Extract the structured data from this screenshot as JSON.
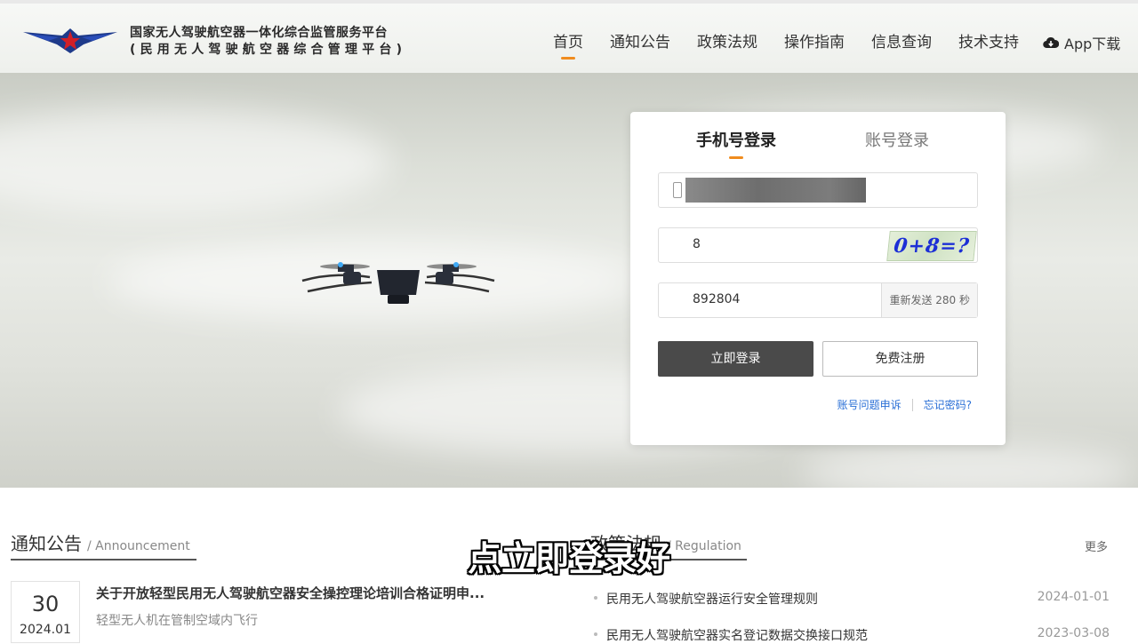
{
  "header": {
    "site_title": "国家无人驾驶航空器一体化综合监管服务平台",
    "site_subtitle": "(民用无人驾驶航空器综合管理平台)",
    "nav": [
      {
        "label": "首页",
        "active": true
      },
      {
        "label": "通知公告"
      },
      {
        "label": "政策法规"
      },
      {
        "label": "操作指南"
      },
      {
        "label": "信息查询"
      },
      {
        "label": "技术支持"
      }
    ],
    "app_download": "App下载"
  },
  "login": {
    "tabs": {
      "phone": "手机号登录",
      "account": "账号登录"
    },
    "phone_field": {
      "masked": true
    },
    "captcha": {
      "value": "8",
      "image_text": "0+8=?"
    },
    "sms_code": {
      "value": "892804",
      "resend_label": "重新发送 280 秒"
    },
    "login_button": "立即登录",
    "register_button": "免费注册",
    "links": {
      "appeal": "账号问题申诉",
      "forgot": "忘记密码?"
    }
  },
  "announcements": {
    "title": "通知公告",
    "title_en": "/ Announcement",
    "items": [
      {
        "day": "30",
        "year_month": "2024.01",
        "title": "关于开放轻型民用无人驾驶航空器安全操控理论培训合格证明申...",
        "summary": "轻型无人机在管制空域内飞行"
      }
    ]
  },
  "regulations": {
    "title": "政策法规",
    "title_en": "/ Regulation",
    "more": "更多",
    "items": [
      {
        "title": "民用无人驾驶航空器运行安全管理规则",
        "date": "2024-01-01"
      },
      {
        "title": "民用无人驾驶航空器实名登记数据交换接口规范",
        "date": "2023-03-08"
      }
    ]
  },
  "subtitle": "点立即登录好",
  "colors": {
    "accent": "#f08c1e",
    "login_button": "#4a4a4a",
    "link": "#2a6fd6"
  }
}
